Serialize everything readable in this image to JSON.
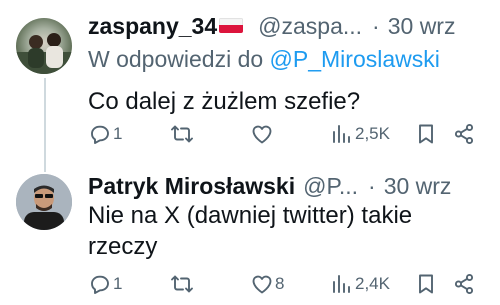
{
  "tweets": [
    {
      "author_name": "zaspany_34",
      "flag": "poland-flag-emoji",
      "handle": "@zaspa...",
      "separator": "·",
      "date": "30 wrz",
      "reply_prefix": "W odpowiedzi do",
      "reply_mention": "@P_Miroslawski",
      "text": "Co dalej z żużlem szefie?",
      "stats": {
        "replies": "1",
        "retweets": "",
        "likes": "",
        "views": "2,5K"
      }
    },
    {
      "author_name": "Patryk Mirosławski",
      "handle": "@P...",
      "separator": "·",
      "date": "30 wrz",
      "text": "Nie na X (dawniej twitter) takie rzeczy",
      "stats": {
        "replies": "1",
        "retweets": "",
        "likes": "8",
        "views": "2,4K"
      }
    }
  ],
  "icons": [
    "reply-icon",
    "retweet-icon",
    "like-icon",
    "views-icon",
    "bookmark-icon",
    "share-icon"
  ],
  "colors": {
    "text": "#0f1419",
    "secondary": "#536471",
    "link": "#1d9bf0",
    "thread_line": "#cfd9de"
  }
}
